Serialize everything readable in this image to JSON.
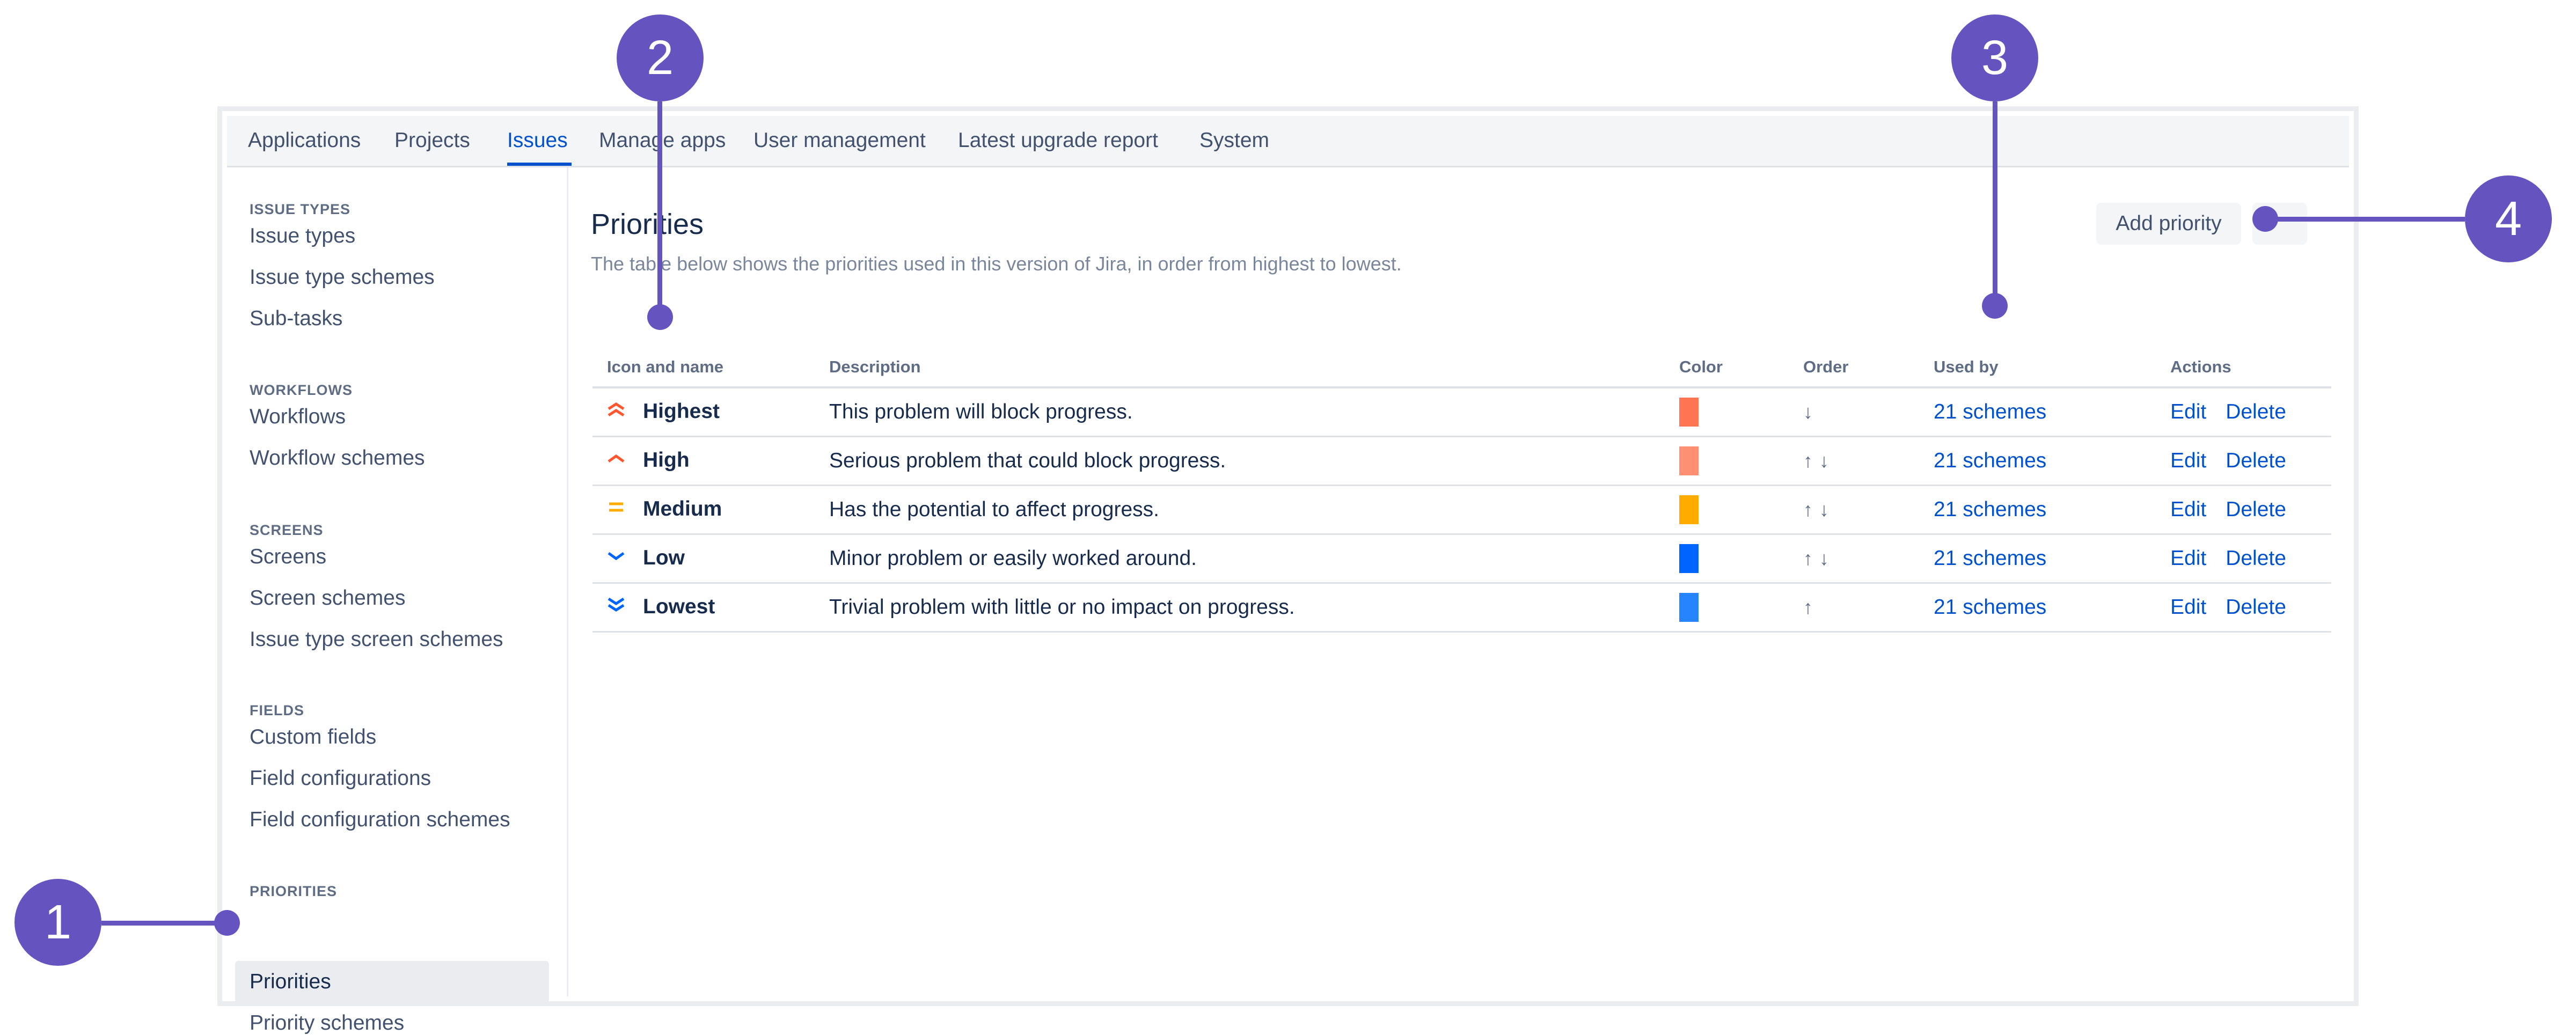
{
  "topnav": {
    "tabs": [
      "Applications",
      "Projects",
      "Issues",
      "Manage apps",
      "User management",
      "Latest upgrade report",
      "System"
    ],
    "active": "Issues"
  },
  "sidebar": {
    "sections": [
      {
        "heading": "ISSUE TYPES",
        "items": [
          "Issue types",
          "Issue type schemes",
          "Sub-tasks"
        ]
      },
      {
        "heading": "WORKFLOWS",
        "items": [
          "Workflows",
          "Workflow schemes"
        ]
      },
      {
        "heading": "SCREENS",
        "items": [
          "Screens",
          "Screen schemes",
          "Issue type screen schemes"
        ]
      },
      {
        "heading": "FIELDS",
        "items": [
          "Custom fields",
          "Field configurations",
          "Field configuration schemes"
        ]
      },
      {
        "heading": "PRIORITIES",
        "items": [
          "Priorities",
          "Priority schemes"
        ]
      }
    ],
    "selected": "Priorities"
  },
  "main": {
    "title": "Priorities",
    "description": "The table below shows the priorities used in this version of Jira, in order from highest to lowest.",
    "add_button": "Add priority"
  },
  "table": {
    "headers": [
      "Icon and name",
      "Description",
      "Color",
      "Order",
      "Used by",
      "Actions"
    ],
    "rows": [
      {
        "name": "Highest",
        "icon": "double-chevron-up-icon",
        "description": "This problem will block progress.",
        "color": "#ff7452",
        "order": [
          "↓"
        ],
        "used_by": "21 schemes",
        "edit": "Edit",
        "delete": "Delete"
      },
      {
        "name": "High",
        "icon": "chevron-up-icon",
        "description": "Serious problem that could block progress.",
        "color": "#ff8f73",
        "order": [
          "↑",
          "↓"
        ],
        "used_by": "21 schemes",
        "edit": "Edit",
        "delete": "Delete"
      },
      {
        "name": "Medium",
        "icon": "equals-icon",
        "description": "Has the potential to affect progress.",
        "color": "#ffab00",
        "order": [
          "↑",
          "↓"
        ],
        "used_by": "21 schemes",
        "edit": "Edit",
        "delete": "Delete"
      },
      {
        "name": "Low",
        "icon": "chevron-down-icon",
        "description": "Minor problem or easily worked around.",
        "color": "#0065ff",
        "order": [
          "↑",
          "↓"
        ],
        "used_by": "21 schemes",
        "edit": "Edit",
        "delete": "Delete"
      },
      {
        "name": "Lowest",
        "icon": "double-chevron-down-icon",
        "description": "Trivial problem with little or no impact on progress.",
        "color": "#2684ff",
        "order": [
          "↑"
        ],
        "used_by": "21 schemes",
        "edit": "Edit",
        "delete": "Delete"
      }
    ]
  },
  "callouts": [
    "1",
    "2",
    "3",
    "4"
  ],
  "colors": {
    "accent": "#0052cc",
    "callout": "#6554c0"
  }
}
